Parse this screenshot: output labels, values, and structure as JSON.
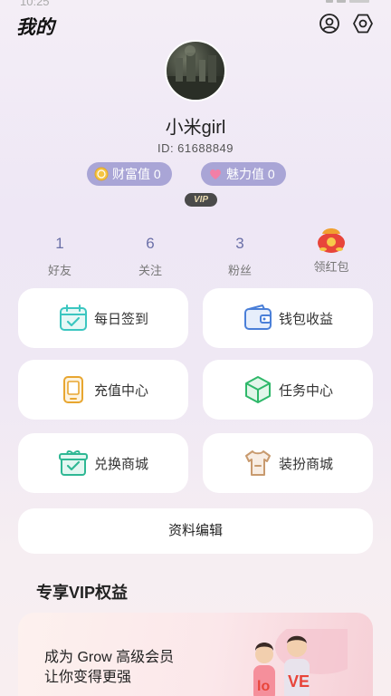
{
  "status_bar": {
    "time": "10:25"
  },
  "header": {
    "title": "我的",
    "profile_icon": "user-circle-icon",
    "settings_icon": "hex-gear-icon"
  },
  "profile": {
    "username": "小米girl",
    "id_text": "ID:  61688849",
    "wealth_label": "财富值 0",
    "charm_label": "魅力值 0",
    "vip_badge": "VIP"
  },
  "stats": [
    {
      "value": "1",
      "label": "好友"
    },
    {
      "value": "6",
      "label": "关注"
    },
    {
      "value": "3",
      "label": "粉丝"
    },
    {
      "label": "领红包",
      "icon": "red-envelope-icon"
    }
  ],
  "menu": [
    {
      "label": "每日签到",
      "icon": "calendar-check-icon",
      "color": "#3bc6c0"
    },
    {
      "label": "钱包收益",
      "icon": "wallet-icon",
      "color": "#4a7fd8"
    },
    {
      "label": "充值中心",
      "icon": "tablet-icon",
      "color": "#e8a630"
    },
    {
      "label": "任务中心",
      "icon": "cube-icon",
      "color": "#2fb86a"
    },
    {
      "label": "兑换商城",
      "icon": "gift-box-icon",
      "color": "#2fb894"
    },
    {
      "label": "装扮商城",
      "icon": "shirt-icon",
      "color": "#c89a6e"
    }
  ],
  "edit_profile_label": "资料编辑",
  "vip_section": {
    "title": "专享VIP权益",
    "banner_line1": "成为 Grow 高级会员",
    "banner_line2": "让你变得更强"
  },
  "colors": {
    "pill_bg": "#a9a5d6",
    "stat_number": "#6b70a8",
    "card_bg": "#ffffff"
  }
}
